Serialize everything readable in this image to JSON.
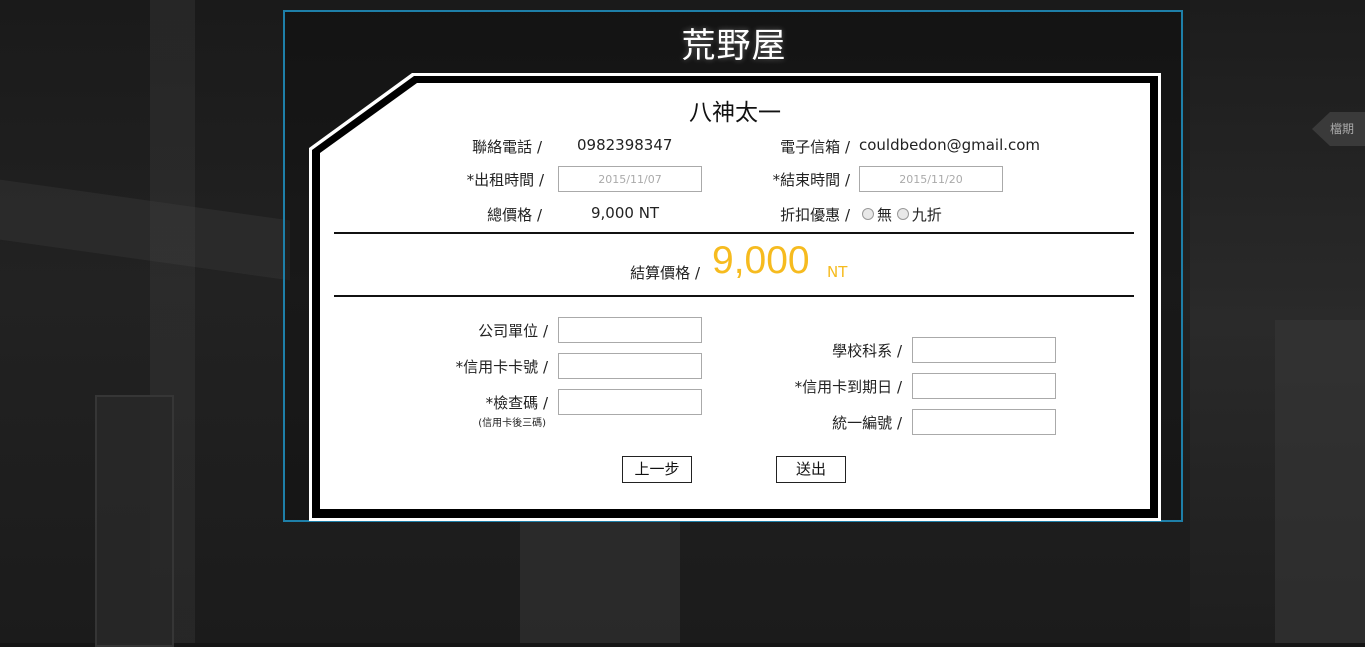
{
  "site_title": "荒野屋",
  "side_tab_label": "檔期",
  "renter_name": "八神太一",
  "info": {
    "phone_label": "聯絡電話 /",
    "phone_value": "0982398347",
    "email_label": "電子信箱 /",
    "email_value": "couldbedon@gmail.com",
    "start_label": "*出租時間 /",
    "start_value": "2015/11/07",
    "end_label": "*結束時間 /",
    "end_value": "2015/11/20",
    "total_label": "總價格 /",
    "total_value": "9,000 NT",
    "discount_label": "折扣優惠 /",
    "discount_options": [
      "無",
      "九折"
    ]
  },
  "settlement": {
    "label": "結算價格 /",
    "amount": "9,000",
    "unit": "NT"
  },
  "form": {
    "company_label": "公司單位 /",
    "card_number_label": "*信用卡卡號 /",
    "cvv_label": "*檢查碼 /",
    "cvv_note": "(信用卡後三碼)",
    "department_label": "學校科系 /",
    "card_expiry_label": "*信用卡到期日 /",
    "tax_id_label": "統一編號 /"
  },
  "buttons": {
    "back": "上一步",
    "submit": "送出"
  },
  "colors": {
    "accent_amount": "#f6bb1f",
    "frame_border": "#1e7fa8"
  }
}
